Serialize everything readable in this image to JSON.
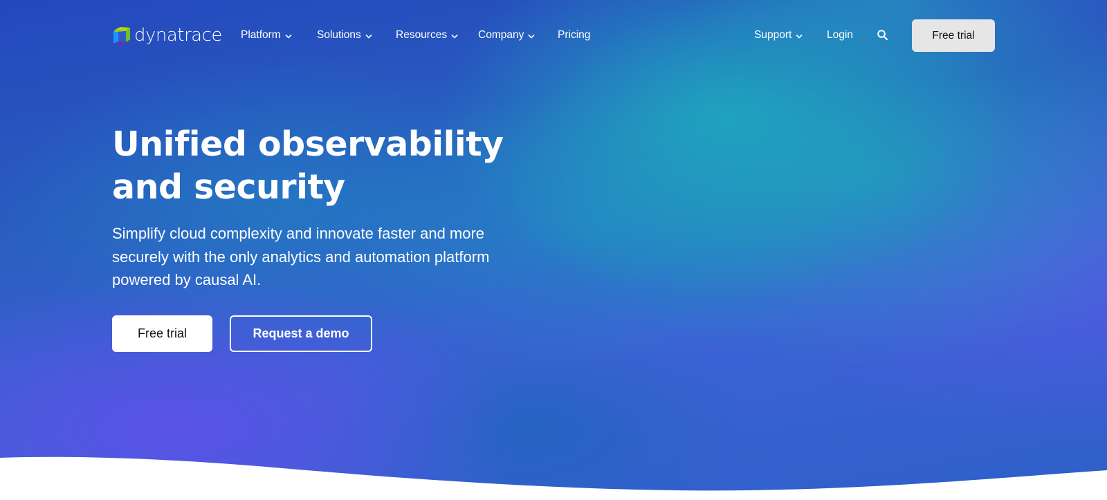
{
  "brand": {
    "name": "dynatrace",
    "logo_icon": "dynatrace-cube-logo",
    "logo_colors": {
      "top": "#8cc63f",
      "left": "#1496ff",
      "bottom": "#6f2da8",
      "right": "#73be28"
    }
  },
  "nav": {
    "left_items": [
      {
        "label": "Platform",
        "has_dropdown": true
      },
      {
        "label": "Solutions",
        "has_dropdown": true
      },
      {
        "label": "Resources",
        "has_dropdown": true
      },
      {
        "label": "Company",
        "has_dropdown": true
      },
      {
        "label": "Pricing",
        "has_dropdown": false
      }
    ],
    "right_items": [
      {
        "label": "Support",
        "has_dropdown": true
      },
      {
        "label": "Login",
        "has_dropdown": false
      }
    ],
    "search_icon": "search-icon",
    "cta_label": "Free trial"
  },
  "hero": {
    "headline_line1": "Unified observability",
    "headline_line2": "and security",
    "subhead": "Simplify cloud complexity and innovate faster and more securely with the only analytics and automation platform powered by causal AI.",
    "primary_button": "Free trial",
    "secondary_button": "Request a demo"
  },
  "colors": {
    "hero_blue": "#2448bd",
    "hero_teal": "#1e9fba",
    "hero_violet": "#5c52e8",
    "cta_bg": "#e6e6e6",
    "text_on_dark": "#ffffff"
  }
}
